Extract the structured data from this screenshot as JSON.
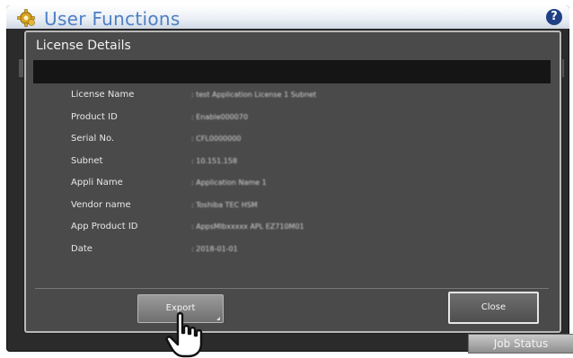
{
  "app": {
    "title": "User Functions",
    "help_icon": "question-mark-icon"
  },
  "dialog": {
    "title": "License Details",
    "rows": [
      {
        "label": "License Name",
        "value": ": test Application License 1 Subnet"
      },
      {
        "label": "Product ID",
        "value": ": Enable000070"
      },
      {
        "label": "Serial No.",
        "value": ": CFL0000000"
      },
      {
        "label": "Subnet",
        "value": ": 10.151.158"
      },
      {
        "label": "Appli Name",
        "value": ": Application Name 1"
      },
      {
        "label": "Vendor name",
        "value": ": Toshiba TEC HSM"
      },
      {
        "label": "App Product ID",
        "value": ": AppsMlbxxxxx APL EZ710M01"
      },
      {
        "label": "Date",
        "value": ": 2018-01-01"
      }
    ],
    "buttons": {
      "export": "Export",
      "close": "Close"
    }
  },
  "footer": {
    "job_status": "Job Status"
  },
  "colors": {
    "title_blue": "#4d7fc4",
    "dialog_bg": "#4a4a4a",
    "band": "#151515"
  }
}
